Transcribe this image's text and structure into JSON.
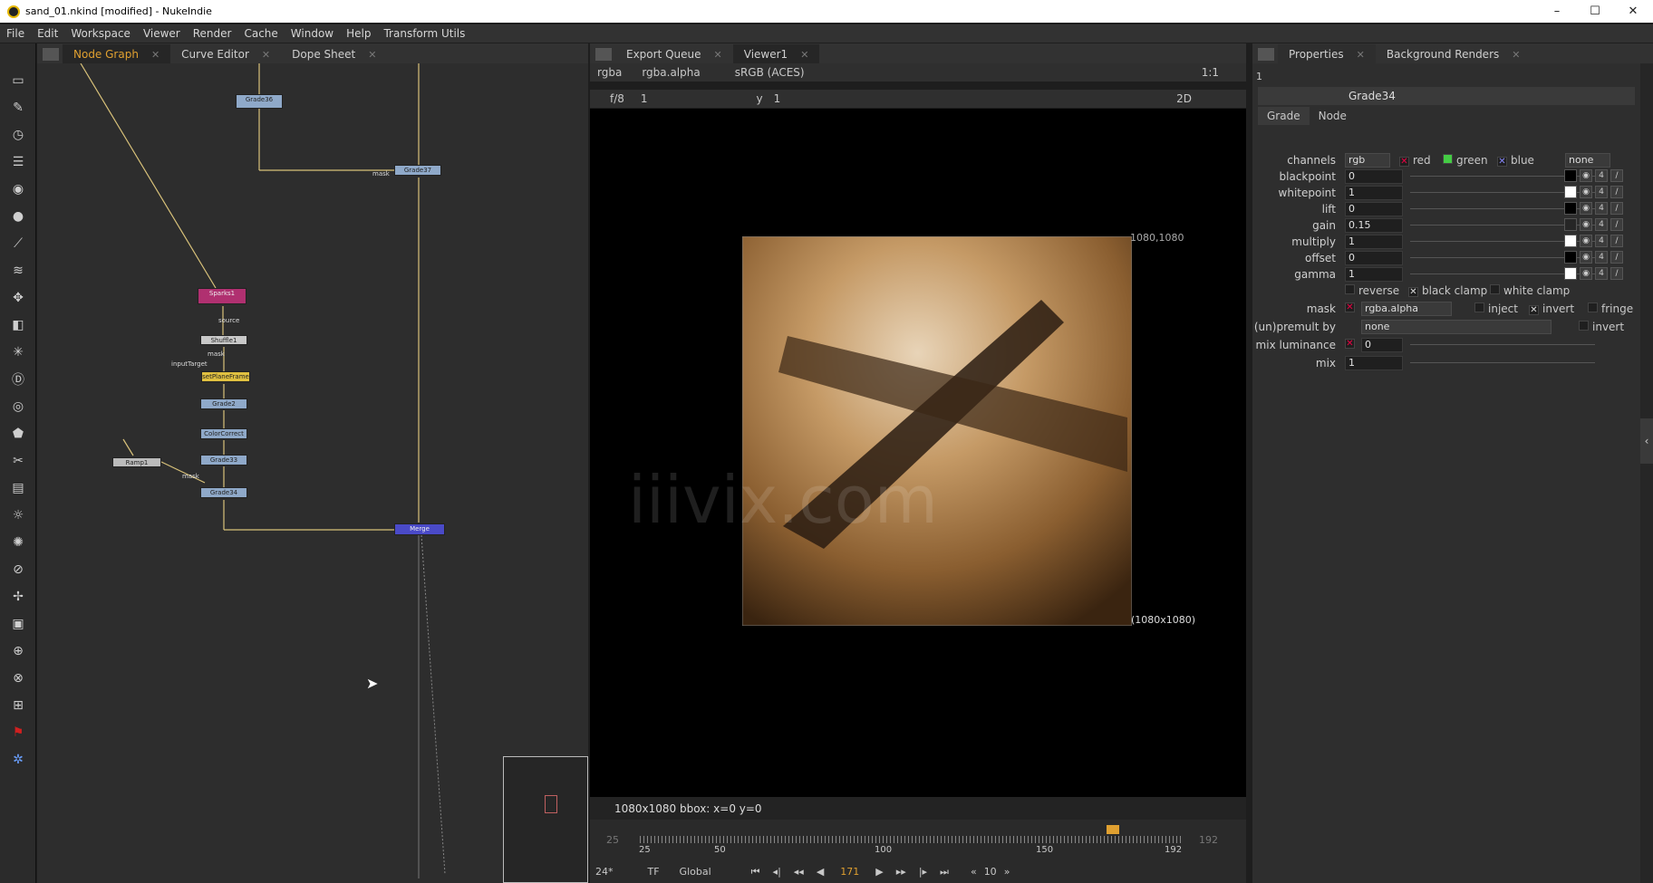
{
  "window": {
    "title": "sand_01.nkind [modified] - NukeIndie",
    "minimize": "–",
    "maximize": "☐",
    "close": "✕"
  },
  "menu": [
    "File",
    "Edit",
    "Workspace",
    "Viewer",
    "Render",
    "Cache",
    "Window",
    "Help",
    "Transform Utils"
  ],
  "left_tabs": [
    {
      "label": "Node Graph"
    },
    {
      "label": "Curve Editor"
    },
    {
      "label": "Dope Sheet"
    }
  ],
  "viewer_tabs": [
    {
      "label": "Export Queue"
    },
    {
      "label": "Viewer1"
    }
  ],
  "props_tabs": [
    {
      "label": "Properties"
    },
    {
      "label": "Background Renders"
    }
  ],
  "tools": [
    "viewer-icon",
    "paint-icon",
    "time-icon",
    "channel-icon",
    "color-icon",
    "filter-icon",
    "keyer-icon",
    "merge-icon",
    "transform-icon",
    "3d-icon",
    "particles-icon",
    "deep-icon",
    "views-icon",
    "metadata-icon",
    "toolsets-icon",
    "other-icon",
    "furnace-icon",
    "cara-icon",
    "ocula-icon",
    "spline-icon",
    "render-icon",
    "grid-icon",
    "hiero-icon",
    "brand-icon",
    "sphere-icon"
  ],
  "graph": {
    "nodes": [
      {
        "id": "grade36",
        "label": "Grade36",
        "color": "#8fa9c9"
      },
      {
        "id": "grade37",
        "label": "Grade37",
        "color": "#8fa9c9"
      },
      {
        "id": "sparks",
        "label": "Sparks1",
        "color": "#b03070"
      },
      {
        "id": "shuffle",
        "label": "Shuffle1",
        "color": "#c8c8c8"
      },
      {
        "id": "roto",
        "label": "setPlaneFrame",
        "color": "#e0c040"
      },
      {
        "id": "grade2",
        "label": "Grade2",
        "color": "#8fa9c9"
      },
      {
        "id": "grade_mid",
        "label": "ColorCorrect",
        "color": "#8fa9c9"
      },
      {
        "id": "grade33",
        "label": "Grade33",
        "color": "#8fa9c9"
      },
      {
        "id": "grade34",
        "label": "Grade34",
        "color": "#8fa9c9"
      },
      {
        "id": "ramp",
        "label": "Ramp1",
        "color": "#bbbbbb"
      },
      {
        "id": "merge",
        "label": "Merge",
        "color": "#4a4ac8"
      }
    ],
    "edge_labels": {
      "source": "source",
      "mask": "mask",
      "mask2": "mask",
      "inputTarget": "inputTarget",
      "mask3": "mask"
    }
  },
  "viewer": {
    "channels": "rgba",
    "alpha": "rgba.alpha",
    "colorspace": "sRGB (ACES)",
    "zoom": "1:1",
    "fstop": "f/8",
    "gain_val": "1",
    "gamma_label": "y",
    "gamma_val": "1",
    "mode": "2D",
    "bbox_top": "1080,1080",
    "bbox_bottom": "(1080x1080)",
    "watermark": "iiivix.com",
    "info": "1080x1080  bbox:  x=0 y=0"
  },
  "timeline": {
    "start": "25",
    "end": "192",
    "ticks": [
      "25",
      "50",
      "100",
      "150",
      "192"
    ],
    "current": "171",
    "fps": "24*",
    "tf": "TF",
    "scope": "Global",
    "step": "10"
  },
  "properties": {
    "node_name": "Grade34",
    "tabs": [
      "Grade",
      "Node"
    ],
    "channels_label": "channels",
    "channels_value": "rgb",
    "red": "red",
    "green": "green",
    "blue": "blue",
    "none": "none",
    "knobs": [
      {
        "label": "blackpoint",
        "value": "0",
        "swatch": "#000000"
      },
      {
        "label": "whitepoint",
        "value": "1",
        "swatch": "#ffffff"
      },
      {
        "label": "lift",
        "value": "0",
        "swatch": "#000000"
      },
      {
        "label": "gain",
        "value": "0.15",
        "swatch": "#262626"
      },
      {
        "label": "multiply",
        "value": "1",
        "swatch": "#ffffff"
      },
      {
        "label": "offset",
        "value": "0",
        "swatch": "#000000"
      },
      {
        "label": "gamma",
        "value": "1",
        "swatch": "#ffffff"
      }
    ],
    "reverse": "reverse",
    "black_clamp": "black clamp",
    "white_clamp": "white clamp",
    "mask_label": "mask",
    "mask_value": "rgba.alpha",
    "inject": "inject",
    "invert": "invert",
    "fringe": "fringe",
    "unpremult_label": "(un)premult by",
    "unpremult_value": "none",
    "invert2": "invert",
    "mixlum_label": "mix luminance",
    "mixlum_value": "0",
    "mix_label": "mix",
    "mix_value": "1",
    "count": "1"
  }
}
